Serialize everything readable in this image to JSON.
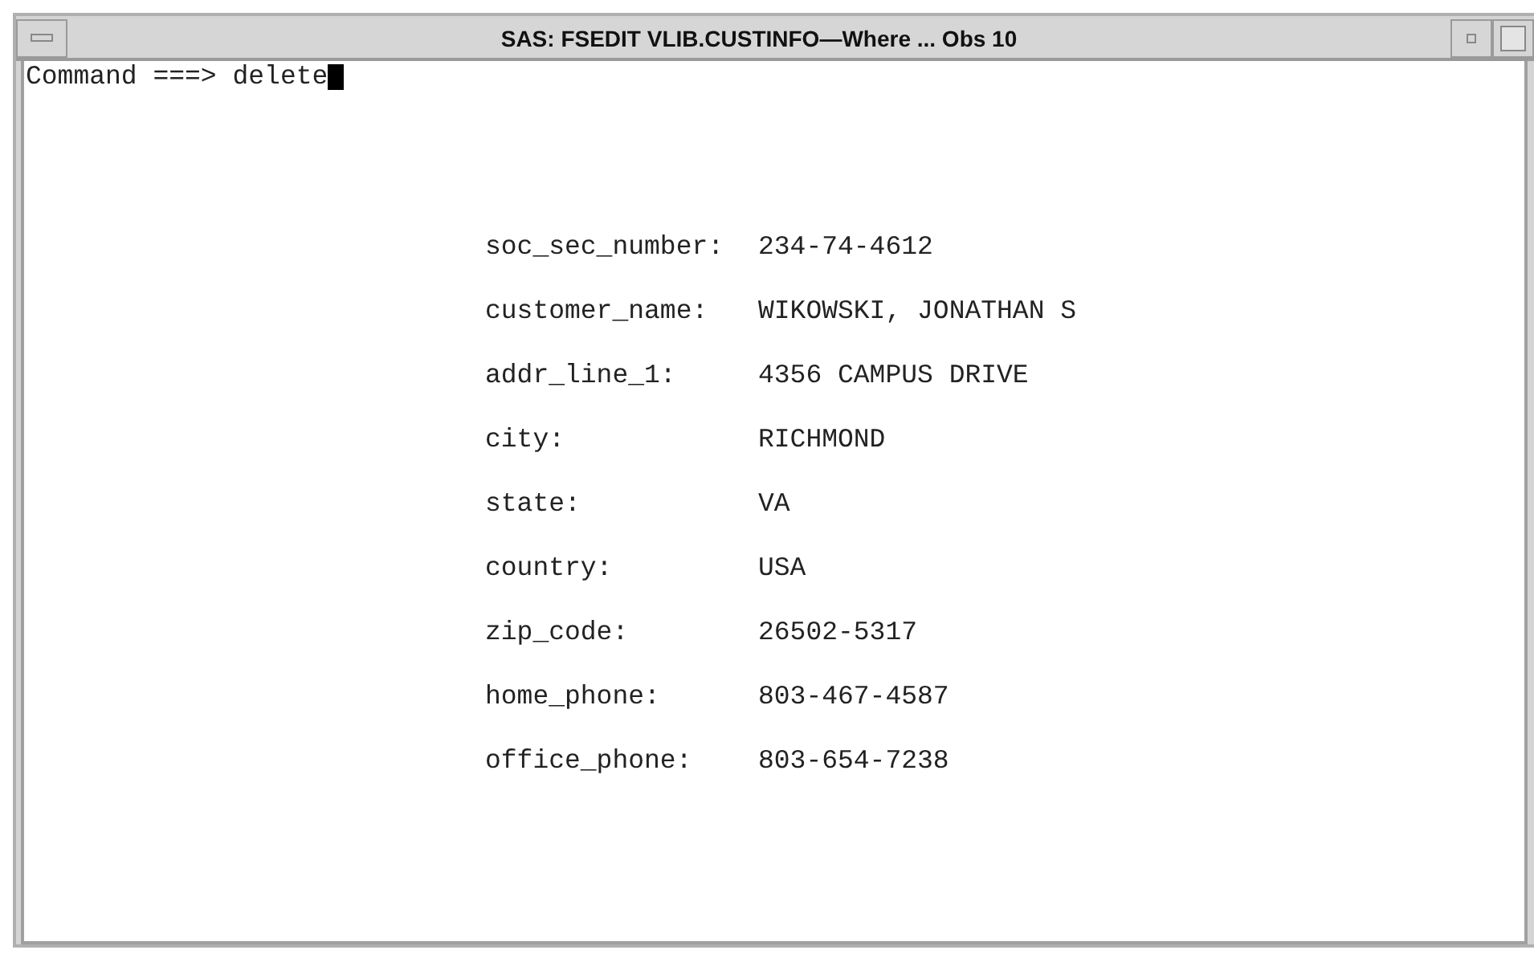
{
  "window": {
    "title": "SAS: FSEDIT VLIB.CUSTINFO—Where ... Obs 10"
  },
  "command": {
    "prompt": "Command ===>",
    "value": "delete"
  },
  "fields": [
    {
      "label": "soc_sec_number:",
      "value": "234-74-4612"
    },
    {
      "label": "customer_name:",
      "value": "WIKOWSKI, JONATHAN S"
    },
    {
      "label": "addr_line_1:",
      "value": "4356 CAMPUS DRIVE"
    },
    {
      "label": "city:",
      "value": "RICHMOND"
    },
    {
      "label": "state:",
      "value": "VA"
    },
    {
      "label": "country:",
      "value": "USA"
    },
    {
      "label": "zip_code:",
      "value": "26502-5317"
    },
    {
      "label": "home_phone:",
      "value": "803-467-4587"
    },
    {
      "label": "office_phone:",
      "value": "803-654-7238"
    }
  ]
}
